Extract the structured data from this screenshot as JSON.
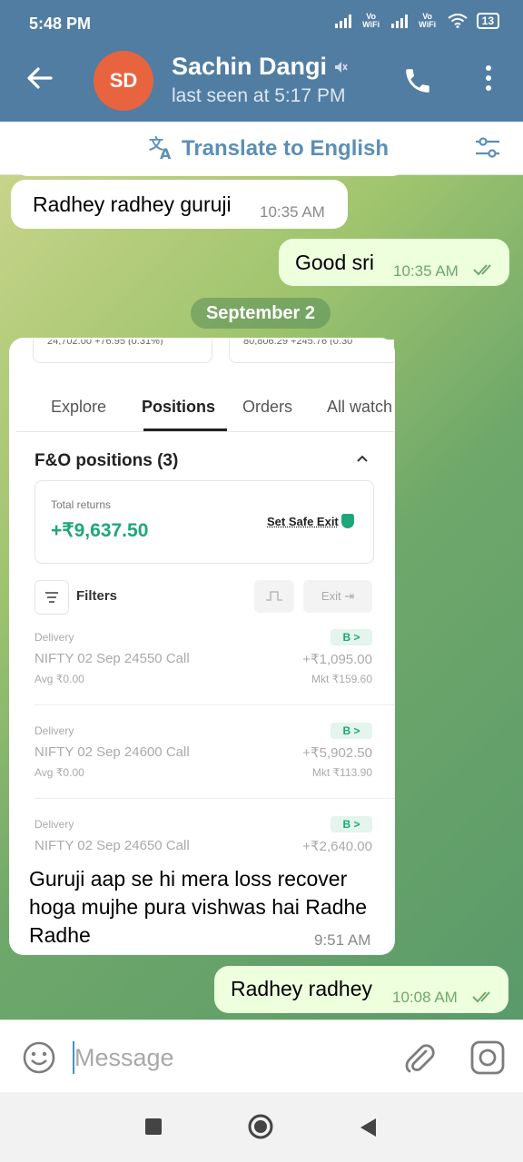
{
  "status_bar": {
    "time": "5:48 PM",
    "vowifi_1": "Vo WiFi",
    "vowifi_2": "Vo WiFi",
    "battery": "13"
  },
  "header": {
    "avatar_initials": "SD",
    "contact_name": "Sachin Dangi",
    "last_seen": "last seen at 5:17 PM"
  },
  "translate_bar": {
    "label": "Translate to English"
  },
  "messages": [
    {
      "direction": "in",
      "text": "Radhey radhey guruji",
      "time": "10:35 AM"
    },
    {
      "direction": "out",
      "text": "Good sri",
      "time": "10:35 AM"
    }
  ],
  "date_separator": "September 2",
  "photo_message": {
    "screenshot": {
      "top_partial_1": "24,702.00 +76.95 (0.31%)",
      "top_partial_2": "80,806.29 +245.76 (0.30",
      "tabs": [
        "Explore",
        "Positions",
        "Orders",
        "All watch"
      ],
      "active_tab": "Positions",
      "section_title": "F&O positions (3)",
      "total_returns_label": "Total returns",
      "total_returns_value": "+₹9,637.50",
      "safe_exit_label": "Set Safe Exit",
      "filters_label": "Filters",
      "exit_label": "Exit",
      "positions": [
        {
          "type": "Delivery",
          "name": "NIFTY 02 Sep 24550 Call",
          "avg": "Avg ₹0.00",
          "badge": "B >",
          "pnl": "+₹1,095.00",
          "mkt": "Mkt ₹159.60"
        },
        {
          "type": "Delivery",
          "name": "NIFTY 02 Sep 24600 Call",
          "avg": "Avg ₹0.00",
          "badge": "B >",
          "pnl": "+₹5,902.50",
          "mkt": "Mkt ₹113.90"
        },
        {
          "type": "Delivery",
          "name": "NIFTY 02 Sep 24650 Call",
          "avg": "",
          "badge": "B >",
          "pnl": "+₹2,640.00",
          "mkt": ""
        }
      ]
    },
    "caption": "Guruji aap se hi mera loss recover hoga mujhe pura vishwas hai Radhe Radhe",
    "time": "9:51 AM"
  },
  "last_message": {
    "direction": "out",
    "text": "Radhey radhey",
    "time": "10:08 AM"
  },
  "composer": {
    "placeholder": "Message"
  },
  "colors": {
    "header": "#517da2",
    "accent": "#5b8fb5",
    "green": "#1ea67b",
    "out_bubble": "#eeffde"
  }
}
